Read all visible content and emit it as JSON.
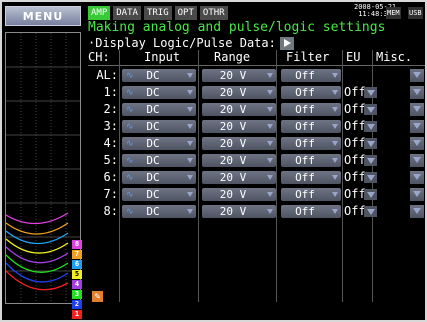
{
  "menu_label": "MENU",
  "tabs": [
    "AMP",
    "DATA",
    "TRIG",
    "OPT",
    "OTHR"
  ],
  "clock": {
    "date": "2008-05-21",
    "time": "11:48:32"
  },
  "status": {
    "mem": "MEM",
    "usb": "USB"
  },
  "heading": "Making analog and pulse/logic settings",
  "subheading": "·Display Logic/Pulse Data:",
  "columns": {
    "ch": "CH:",
    "input": "Input",
    "range": "Range",
    "filter": "Filter",
    "eu": "EU",
    "misc": "Misc."
  },
  "rows": [
    {
      "ch": "AL:",
      "input": "DC",
      "range": "20 V",
      "filter": "Off",
      "eu": ""
    },
    {
      "ch": "1:",
      "input": "DC",
      "range": "20 V",
      "filter": "Off",
      "eu": "Off"
    },
    {
      "ch": "2:",
      "input": "DC",
      "range": "20 V",
      "filter": "Off",
      "eu": "Off"
    },
    {
      "ch": "3:",
      "input": "DC",
      "range": "20 V",
      "filter": "Off",
      "eu": "Off"
    },
    {
      "ch": "4:",
      "input": "DC",
      "range": "20 V",
      "filter": "Off",
      "eu": "Off"
    },
    {
      "ch": "5:",
      "input": "DC",
      "range": "20 V",
      "filter": "Off",
      "eu": "Off"
    },
    {
      "ch": "6:",
      "input": "DC",
      "range": "20 V",
      "filter": "Off",
      "eu": "Off"
    },
    {
      "ch": "7:",
      "input": "DC",
      "range": "20 V",
      "filter": "Off",
      "eu": "Off"
    },
    {
      "ch": "8:",
      "input": "DC",
      "range": "20 V",
      "filter": "Off",
      "eu": "Off"
    }
  ],
  "channel_markers": [
    {
      "label": "8",
      "color": "#e040e0"
    },
    {
      "label": "7",
      "color": "#f0a020"
    },
    {
      "label": "6",
      "color": "#20a0f0"
    },
    {
      "label": "5",
      "color": "#f0f020"
    },
    {
      "label": "4",
      "color": "#a040e0"
    },
    {
      "label": "3",
      "color": "#20e020"
    },
    {
      "label": "2",
      "color": "#2040f0"
    },
    {
      "label": "1",
      "color": "#f02020"
    }
  ],
  "colors": {
    "tab_active": "#38c838",
    "heading": "#48e848",
    "background": "#000000"
  }
}
